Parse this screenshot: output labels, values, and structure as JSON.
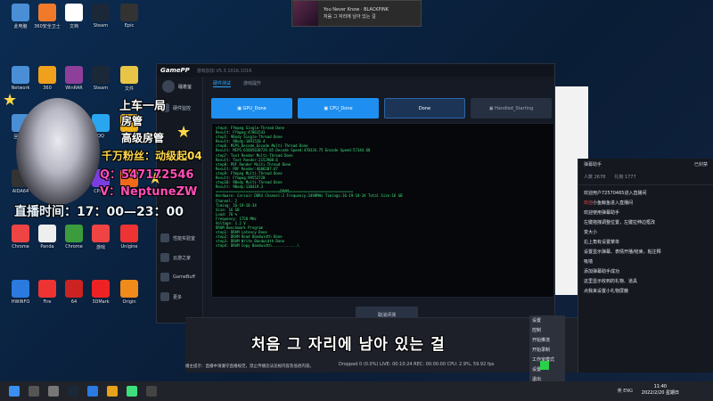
{
  "media": {
    "line1": "You Never Know · BLACKPINK",
    "line2": "처음 그 자리에 남아 있는 걸"
  },
  "desktop_icons": [
    {
      "label": "此电脑",
      "color": "#4a8fd6"
    },
    {
      "label": "360安全卫士",
      "color": "#f07a2a"
    },
    {
      "label": "文档",
      "color": "#ffffff"
    },
    {
      "label": "Steam",
      "color": "#1b2838"
    },
    {
      "label": "Epic",
      "color": "#333333"
    },
    {
      "label": "Network",
      "color": "#4a8fd6"
    },
    {
      "label": "360",
      "color": "#f0a01a"
    },
    {
      "label": "WinRAR",
      "color": "#8d3f9a"
    },
    {
      "label": "Steam",
      "color": "#1b2838"
    },
    {
      "label": "文件",
      "color": "#e8c547"
    },
    {
      "label": "回收站",
      "color": "#4a8fd6"
    },
    {
      "label": "CS",
      "color": "#e6a21a"
    },
    {
      "label": "B站",
      "color": "#d44"
    },
    {
      "label": "QQ",
      "color": "#2aa6f0"
    },
    {
      "label": "V",
      "color": "#f0b21a"
    },
    {
      "label": "AIDA64",
      "color": "#333"
    },
    {
      "label": "Microsoft Edge",
      "color": "#1f88d9"
    },
    {
      "label": "PUBG",
      "color": "#cc4"
    },
    {
      "label": "CPU-Z",
      "color": "#7a3ee0"
    },
    {
      "label": "Firefox",
      "color": "#f06a1a"
    },
    {
      "label": "Chrome",
      "color": "#e44"
    },
    {
      "label": "Panda",
      "color": "#eeeeee"
    },
    {
      "label": "Chrome",
      "color": "#3c9b3c"
    },
    {
      "label": "游戏",
      "color": "#e44"
    },
    {
      "label": "Unigine",
      "color": "#e33"
    },
    {
      "label": "HWiNFO",
      "color": "#2a7ae0"
    },
    {
      "label": "Fire",
      "color": "#e33"
    },
    {
      "label": "64",
      "color": "#c22"
    },
    {
      "label": "3DMark",
      "color": "#e22"
    },
    {
      "label": "Origin",
      "color": "#f08a1a"
    }
  ],
  "app": {
    "brand": "GamePP",
    "version": "游戏加加 V5.3.1016.1016",
    "user_name": "睡着萤",
    "sidebar": [
      "硬件监控",
      "性能实验室",
      "云游之家",
      "GameBuff",
      "更多"
    ],
    "tabs": [
      "硬件测试",
      "游戏提升"
    ],
    "steps": [
      "GPU_Done",
      "CPU_Done",
      "Done",
      "Handled_Starting"
    ],
    "console_lines": [
      "step4: Ffmpeg Single-Thread Done",
      "Result: Ffmpeg:47061543",
      "step5: 9Body Single-Thread Done",
      "Result: 9Body:1891528.4",
      "step6: MIPS_Decode_Encode Multi-Thread Done",
      "Result: MIPS:65685630729.85 Decode Speed:470334.75 Encode Speed:57344.68",
      "step7: Text Render Multi-Thread Done",
      "Result: Text Render:2152908.6",
      "step8: PDF Render Multi-Thread Done",
      "Result: PDF Render:4686207.67",
      "step9: Ffmpeg Multi-Thread Done",
      "Result: Ffmpeg:99552720",
      "step10: 9Body Multi-Thread Done",
      "Result: 9Body:130419.3",
      "",
      "==============================DRAM==============================",
      "Hardware: Corsair DDR4 Channel:2 Frequency:3498MHz Timings:16-19-18-34 Total Size:16 GB",
      "Channel: 2",
      "Timing: 16-19-18-34",
      "Size: 16 GB",
      "Load: 76 %",
      "Frequency: 1750 MHz",
      "Voltage: 1.2 V",
      "",
      "DRAM Benchmark Program",
      "step1: DRAM Latency Done",
      "step2: DRAM Read Bandwidth Done",
      "step3: DRAM Write Bandwidth Done",
      "step4: DRAM Copy Bandwidth............\\"
    ],
    "cancel_label": "取消评测"
  },
  "overlay": {
    "line1": "上车一局",
    "line2": "房管",
    "line3": "高级房管",
    "line4": "千万粉丝：动级起04",
    "line5": "Q：547172546",
    "line6": "V：NeptuneZW",
    "line7": "直播时间：17：00—23：00"
  },
  "chat": {
    "header_left": "弹幕助手",
    "header_right": "已封禁",
    "stats": [
      "人数 2678",
      "礼物 1777"
    ],
    "lines": [
      {
        "nick": "",
        "text": "欢迎用户72570465进入直播间"
      },
      {
        "nick": "欢迎",
        "text": "小鱼鲸鱼进入直播间"
      },
      {
        "nick": "",
        "text": "欢迎使用弹幕助手"
      },
      {
        "nick": "",
        "text": "左键拖拽调整位置，左键拉伸边框改"
      },
      {
        "nick": "",
        "text": "变大小"
      },
      {
        "nick": "",
        "text": "右上角有设置菜单"
      },
      {
        "nick": "",
        "text": "设置显示弹幕、表情开播/结束，粘注释"
      },
      {
        "nick": "",
        "text": "吸墙"
      },
      {
        "nick": "",
        "text": "添加弹幕助手成功"
      },
      {
        "nick": "",
        "text": "这里显示收到的礼物、道具"
      },
      {
        "nick": "",
        "text": "点我来设置小礼物屏蔽"
      }
    ]
  },
  "obs": {
    "menu": [
      "设置",
      "控制",
      "开始推流",
      "开始录制",
      "工作室模式",
      "设置",
      "退出"
    ],
    "status": "Dropped 0 (0.0%)  LIVE: 00:10:24  REC: 00:00:00  CPU: 2.9%, 59.92 fps",
    "marquee": "播主提示：直播中请遵守直播规范，禁止传播违法违规内容及低俗内容。"
  },
  "subtitle": "처음 그 자리에 남아 있는 걸",
  "clock": {
    "time": "11:40",
    "date": "2022/2/20 星期日"
  },
  "tray": "英 ENG"
}
